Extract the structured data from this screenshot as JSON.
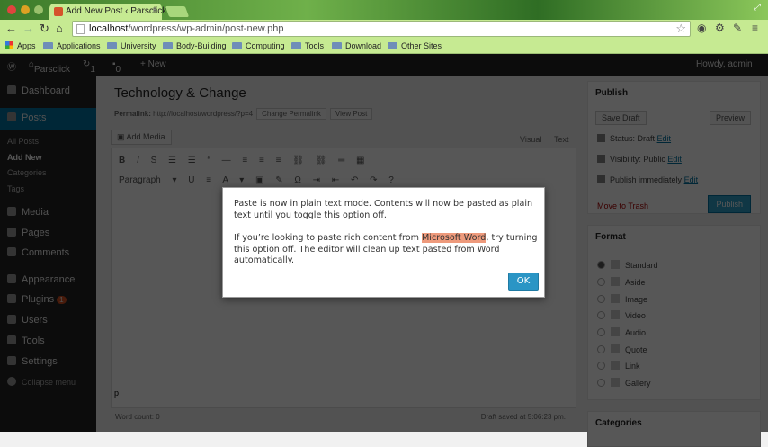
{
  "browser": {
    "tab_title": "Add New Post ‹ Parsclick",
    "url_host": "localhost",
    "url_path": "/wordpress/wp-admin/post-new.php",
    "bookmarks": [
      "Apps",
      "Applications",
      "University",
      "Body-Building",
      "Computing",
      "Tools",
      "Download",
      "Other Sites"
    ]
  },
  "adminbar": {
    "site": "Parsclick",
    "updates": "1",
    "comments": "0",
    "new": "+ New",
    "greeting": "Howdy, admin"
  },
  "sidebar": {
    "items": [
      "Dashboard",
      "Posts",
      "Media",
      "Pages",
      "Comments",
      "Appearance",
      "Plugins",
      "Users",
      "Tools",
      "Settings",
      "Collapse menu"
    ],
    "subitems": [
      "All Posts",
      "Add New",
      "Categories",
      "Tags"
    ],
    "plugins_badge": "1"
  },
  "editor": {
    "title": "Technology & Change",
    "permalink_label": "Permalink:",
    "permalink": "http://localhost/wordpress/?p=4",
    "change_permalink": "Change Permalink",
    "view_post": "View Post",
    "add_media": "Add Media",
    "visual": "Visual",
    "text": "Text",
    "format_select": "Paragraph",
    "path": "p",
    "word_count": "Word count: 0",
    "draft_saved": "Draft saved at 5:06:23 pm."
  },
  "publish": {
    "heading": "Publish",
    "save_draft": "Save Draft",
    "preview": "Preview",
    "status": "Status: Draft",
    "visibility": "Visibility: Public",
    "schedule": "Publish immediately",
    "edit": "Edit",
    "trash": "Move to Trash",
    "publish": "Publish"
  },
  "format": {
    "heading": "Format",
    "options": [
      "Standard",
      "Aside",
      "Image",
      "Video",
      "Audio",
      "Quote",
      "Link",
      "Gallery"
    ],
    "selected": "Standard"
  },
  "categories": {
    "heading": "Categories"
  },
  "dialog": {
    "line1": "Paste is now in plain text mode. Contents will now be pasted as plain text until you toggle this option off.",
    "line2_pre": "If you’re looking to paste rich content from ",
    "line2_hl": "Microsoft Word",
    "line2_post": ", try turning this option off. The editor will clean up text pasted from Word automatically.",
    "ok": "OK"
  }
}
